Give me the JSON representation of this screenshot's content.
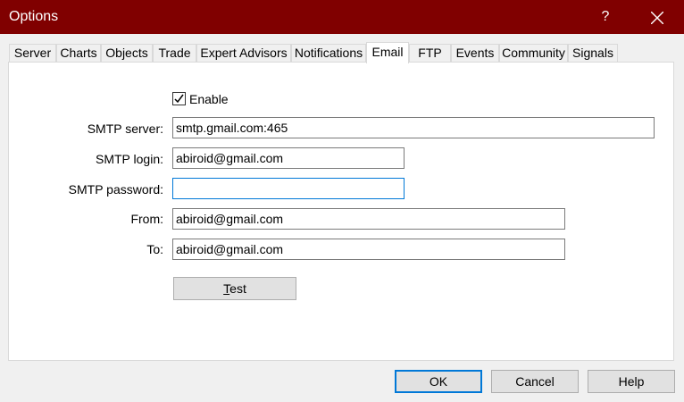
{
  "window": {
    "title": "Options",
    "help_symbol": "?"
  },
  "tabs": [
    {
      "label": "Server"
    },
    {
      "label": "Charts"
    },
    {
      "label": "Objects"
    },
    {
      "label": "Trade"
    },
    {
      "label": "Expert Advisors"
    },
    {
      "label": "Notifications"
    },
    {
      "label": "Email",
      "active": true
    },
    {
      "label": "FTP"
    },
    {
      "label": "Events"
    },
    {
      "label": "Community"
    },
    {
      "label": "Signals"
    }
  ],
  "email": {
    "enable_label": "Enable",
    "enable_checked": true,
    "smtp_server_label": "SMTP server:",
    "smtp_server_value": "smtp.gmail.com:465",
    "smtp_login_label": "SMTP login:",
    "smtp_login_value": "abiroid@gmail.com",
    "smtp_password_label": "SMTP password:",
    "smtp_password_value": "",
    "from_label": "From:",
    "from_value": "abiroid@gmail.com",
    "to_label": "To:",
    "to_value": "abiroid@gmail.com",
    "test_button": "Test"
  },
  "footer": {
    "ok_label": "OK",
    "cancel_label": "Cancel",
    "help_label": "Help"
  },
  "colors": {
    "titlebar": "#800000",
    "focus_border": "#0078d7"
  }
}
